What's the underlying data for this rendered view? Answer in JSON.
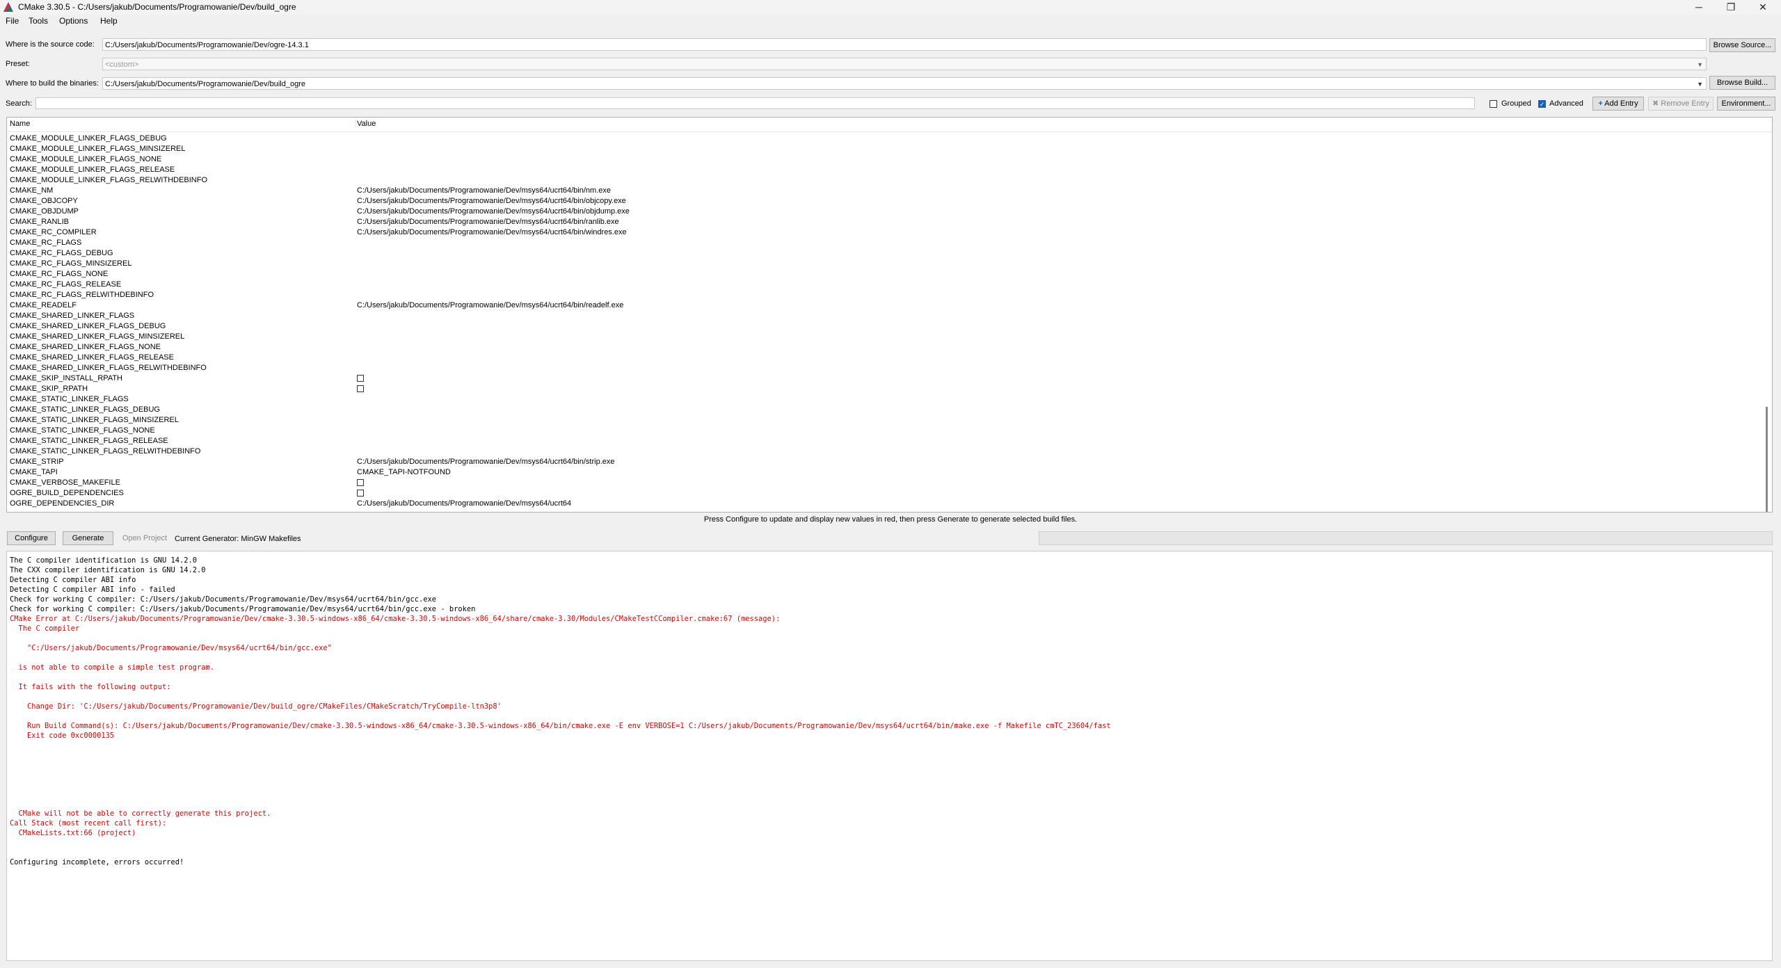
{
  "window": {
    "title": "CMake 3.30.5 - C:/Users/jakub/Documents/Programowanie/Dev/build_ogre",
    "controls": {
      "minimize": "─",
      "maximize": "❐",
      "close": "✕"
    }
  },
  "menu": [
    "File",
    "Tools",
    "Options",
    "Help"
  ],
  "source": {
    "label": "Where is the source code:",
    "value": "C:/Users/jakub/Documents/Programowanie/Dev/ogre-14.3.1",
    "button": "Browse Source..."
  },
  "preset": {
    "label": "Preset:",
    "value": "<custom>"
  },
  "build": {
    "label": "Where to build the binaries:",
    "value": "C:/Users/jakub/Documents/Programowanie/Dev/build_ogre",
    "button": "Browse Build..."
  },
  "search": {
    "label": "Search:",
    "grouped": "Grouped",
    "grouped_checked": false,
    "advanced": "Advanced",
    "advanced_checked": true,
    "add_entry": "Add Entry",
    "remove_entry": "Remove Entry",
    "environment": "Environment..."
  },
  "table": {
    "col_name": "Name",
    "col_value": "Value",
    "rows": [
      {
        "name": "CMAKE_MODULE_LINKER_FLAGS_DEBUG",
        "value": ""
      },
      {
        "name": "CMAKE_MODULE_LINKER_FLAGS_MINSIZEREL",
        "value": ""
      },
      {
        "name": "CMAKE_MODULE_LINKER_FLAGS_NONE",
        "value": ""
      },
      {
        "name": "CMAKE_MODULE_LINKER_FLAGS_RELEASE",
        "value": ""
      },
      {
        "name": "CMAKE_MODULE_LINKER_FLAGS_RELWITHDEBINFO",
        "value": ""
      },
      {
        "name": "CMAKE_NM",
        "value": "C:/Users/jakub/Documents/Programowanie/Dev/msys64/ucrt64/bin/nm.exe"
      },
      {
        "name": "CMAKE_OBJCOPY",
        "value": "C:/Users/jakub/Documents/Programowanie/Dev/msys64/ucrt64/bin/objcopy.exe"
      },
      {
        "name": "CMAKE_OBJDUMP",
        "value": "C:/Users/jakub/Documents/Programowanie/Dev/msys64/ucrt64/bin/objdump.exe"
      },
      {
        "name": "CMAKE_RANLIB",
        "value": "C:/Users/jakub/Documents/Programowanie/Dev/msys64/ucrt64/bin/ranlib.exe"
      },
      {
        "name": "CMAKE_RC_COMPILER",
        "value": "C:/Users/jakub/Documents/Programowanie/Dev/msys64/ucrt64/bin/windres.exe"
      },
      {
        "name": "CMAKE_RC_FLAGS",
        "value": ""
      },
      {
        "name": "CMAKE_RC_FLAGS_DEBUG",
        "value": ""
      },
      {
        "name": "CMAKE_RC_FLAGS_MINSIZEREL",
        "value": ""
      },
      {
        "name": "CMAKE_RC_FLAGS_NONE",
        "value": ""
      },
      {
        "name": "CMAKE_RC_FLAGS_RELEASE",
        "value": ""
      },
      {
        "name": "CMAKE_RC_FLAGS_RELWITHDEBINFO",
        "value": ""
      },
      {
        "name": "CMAKE_READELF",
        "value": "C:/Users/jakub/Documents/Programowanie/Dev/msys64/ucrt64/bin/readelf.exe"
      },
      {
        "name": "CMAKE_SHARED_LINKER_FLAGS",
        "value": ""
      },
      {
        "name": "CMAKE_SHARED_LINKER_FLAGS_DEBUG",
        "value": ""
      },
      {
        "name": "CMAKE_SHARED_LINKER_FLAGS_MINSIZEREL",
        "value": ""
      },
      {
        "name": "CMAKE_SHARED_LINKER_FLAGS_NONE",
        "value": ""
      },
      {
        "name": "CMAKE_SHARED_LINKER_FLAGS_RELEASE",
        "value": ""
      },
      {
        "name": "CMAKE_SHARED_LINKER_FLAGS_RELWITHDEBINFO",
        "value": ""
      },
      {
        "name": "CMAKE_SKIP_INSTALL_RPATH",
        "value": "",
        "checkbox": true
      },
      {
        "name": "CMAKE_SKIP_RPATH",
        "value": "",
        "checkbox": true
      },
      {
        "name": "CMAKE_STATIC_LINKER_FLAGS",
        "value": ""
      },
      {
        "name": "CMAKE_STATIC_LINKER_FLAGS_DEBUG",
        "value": ""
      },
      {
        "name": "CMAKE_STATIC_LINKER_FLAGS_MINSIZEREL",
        "value": ""
      },
      {
        "name": "CMAKE_STATIC_LINKER_FLAGS_NONE",
        "value": ""
      },
      {
        "name": "CMAKE_STATIC_LINKER_FLAGS_RELEASE",
        "value": ""
      },
      {
        "name": "CMAKE_STATIC_LINKER_FLAGS_RELWITHDEBINFO",
        "value": ""
      },
      {
        "name": "CMAKE_STRIP",
        "value": "C:/Users/jakub/Documents/Programowanie/Dev/msys64/ucrt64/bin/strip.exe"
      },
      {
        "name": "CMAKE_TAPI",
        "value": "CMAKE_TAPI-NOTFOUND"
      },
      {
        "name": "CMAKE_VERBOSE_MAKEFILE",
        "value": "",
        "checkbox": true
      },
      {
        "name": "OGRE_BUILD_DEPENDENCIES",
        "value": "",
        "checkbox": true
      },
      {
        "name": "OGRE_DEPENDENCIES_DIR",
        "value": "C:/Users/jakub/Documents/Programowanie/Dev/msys64/ucrt64"
      }
    ]
  },
  "hint": "Press Configure to update and display new values in red, then press Generate to generate selected build files.",
  "actions": {
    "configure": "Configure",
    "generate": "Generate",
    "open_project": "Open Project",
    "generator": "Current Generator: MinGW Makefiles"
  },
  "output": [
    {
      "t": "The C compiler identification is GNU 14.2.0",
      "err": false
    },
    {
      "t": "The CXX compiler identification is GNU 14.2.0",
      "err": false
    },
    {
      "t": "Detecting C compiler ABI info",
      "err": false
    },
    {
      "t": "Detecting C compiler ABI info - failed",
      "err": false
    },
    {
      "t": "Check for working C compiler: C:/Users/jakub/Documents/Programowanie/Dev/msys64/ucrt64/bin/gcc.exe",
      "err": false
    },
    {
      "t": "Check for working C compiler: C:/Users/jakub/Documents/Programowanie/Dev/msys64/ucrt64/bin/gcc.exe - broken",
      "err": false
    },
    {
      "t": "CMake Error at C:/Users/jakub/Documents/Programowanie/Dev/cmake-3.30.5-windows-x86_64/cmake-3.30.5-windows-x86_64/share/cmake-3.30/Modules/CMakeTestCCompiler.cmake:67 (message):",
      "err": true
    },
    {
      "t": "  The C compiler",
      "err": true
    },
    {
      "t": "",
      "err": true
    },
    {
      "t": "    \"C:/Users/jakub/Documents/Programowanie/Dev/msys64/ucrt64/bin/gcc.exe\"",
      "err": true
    },
    {
      "t": "",
      "err": true
    },
    {
      "t": "  is not able to compile a simple test program.",
      "err": true
    },
    {
      "t": "",
      "err": true
    },
    {
      "t": "  It fails with the following output:",
      "err": true
    },
    {
      "t": "",
      "err": true
    },
    {
      "t": "    Change Dir: 'C:/Users/jakub/Documents/Programowanie/Dev/build_ogre/CMakeFiles/CMakeScratch/TryCompile-ltn3p8'",
      "err": true
    },
    {
      "t": "",
      "err": true
    },
    {
      "t": "    Run Build Command(s): C:/Users/jakub/Documents/Programowanie/Dev/cmake-3.30.5-windows-x86_64/cmake-3.30.5-windows-x86_64/bin/cmake.exe -E env VERBOSE=1 C:/Users/jakub/Documents/Programowanie/Dev/msys64/ucrt64/bin/make.exe -f Makefile cmTC_23604/fast",
      "err": true
    },
    {
      "t": "    Exit code 0xc0000135",
      "err": true
    },
    {
      "t": "",
      "err": true
    },
    {
      "t": "",
      "err": true
    },
    {
      "t": "",
      "err": true
    },
    {
      "t": "",
      "err": true
    },
    {
      "t": "",
      "err": true
    },
    {
      "t": "",
      "err": true
    },
    {
      "t": "",
      "err": true
    },
    {
      "t": "  CMake will not be able to correctly generate this project.",
      "err": true
    },
    {
      "t": "Call Stack (most recent call first):",
      "err": true
    },
    {
      "t": "  CMakeLists.txt:66 (project)",
      "err": true
    },
    {
      "t": "",
      "err": false
    },
    {
      "t": "",
      "err": false
    },
    {
      "t": "Configuring incomplete, errors occurred!",
      "err": false
    }
  ],
  "colors": {
    "error": "#e00000",
    "checkbox_checked": "#1a5fb4",
    "cmake_logo": [
      "#d32f2f",
      "#1565c0",
      "#2e7d32"
    ]
  }
}
